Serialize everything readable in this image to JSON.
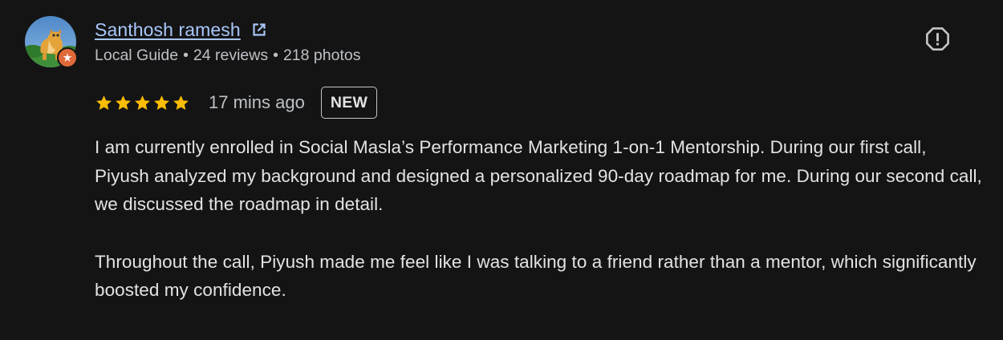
{
  "author": {
    "name": "Santhosh ramesh",
    "meta": {
      "level": "Local Guide",
      "reviews": "24 reviews",
      "photos": "218 photos",
      "separator": "•"
    }
  },
  "rating": {
    "stars": 5,
    "max_stars": 5,
    "star_color": "#fbbc04",
    "time_ago": "17 mins ago",
    "badge": "NEW"
  },
  "review": {
    "paragraphs": [
      "I am currently enrolled in Social Masla’s Performance Marketing 1-on-1 Mentorship. During our first call, Piyush analyzed my background and designed a personalized 90-day roadmap for me. During our second call, we discussed the roadmap in detail.",
      "Throughout the call, Piyush made me feel like I was talking to a friend rather than a mentor, which significantly boosted my confidence."
    ]
  },
  "icons": {
    "external": "open-in-new-icon",
    "report": "report-flag-icon",
    "guide_badge": "local-guide-badge-icon"
  },
  "colors": {
    "background": "#141414",
    "link": "#a8c7fa",
    "text": "#e3e3e3",
    "secondary_text": "#bdc1c6",
    "badge": "#e0693a"
  }
}
